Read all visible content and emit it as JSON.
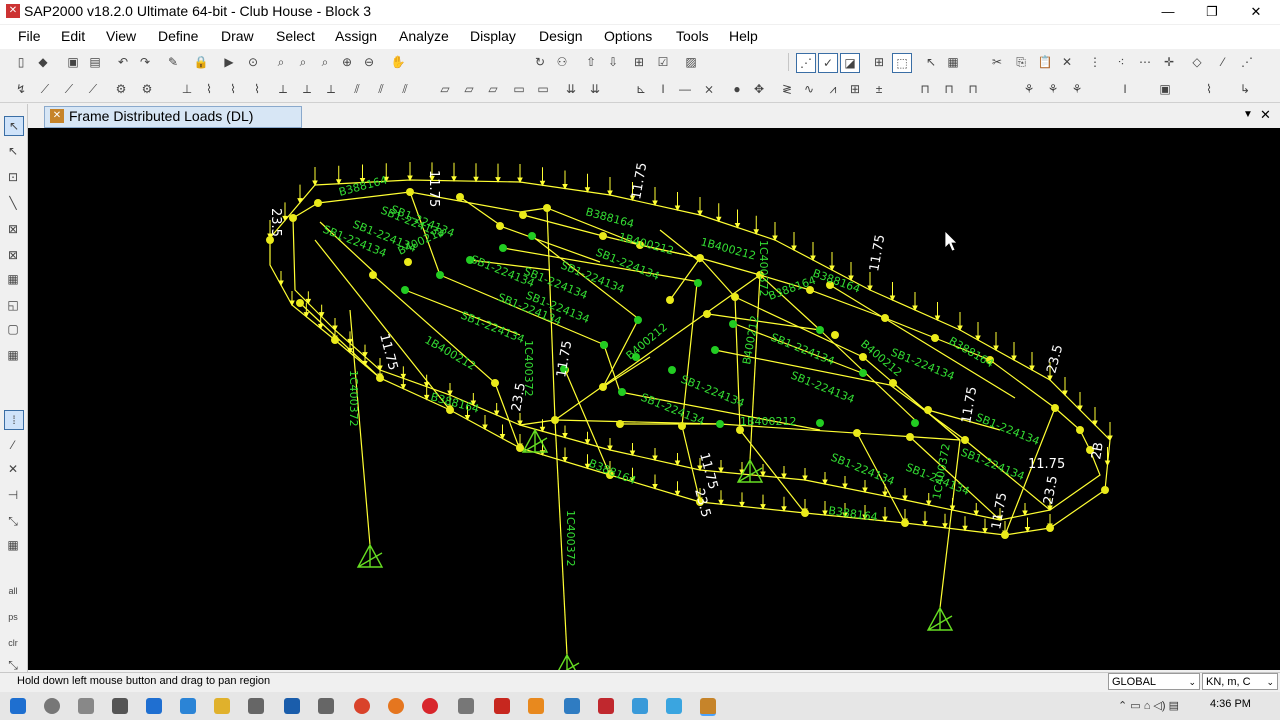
{
  "window": {
    "title": "SAP2000 v18.2.0 Ultimate 64-bit - Club House - Block 3",
    "icon": "sap2000-logo-icon",
    "controls": [
      "—",
      "❐",
      "✕"
    ]
  },
  "menu": [
    "File",
    "Edit",
    "View",
    "Define",
    "Draw",
    "Select",
    "Assign",
    "Analyze",
    "Display",
    "Design",
    "Options",
    "Tools",
    "Help"
  ],
  "toolbar": {
    "view_buttons": [
      "3-d",
      "xy",
      "xz",
      "yz",
      "nv"
    ]
  },
  "tab": {
    "label": "Frame Distributed Loads (DL)",
    "dropdown_glyph": "▼",
    "close_glyph": "✕"
  },
  "model": {
    "labels": {
      "beam_small": [
        "B388164",
        "B388164",
        "B388164",
        "B388164",
        "B388164",
        "B388164",
        "B388164",
        "B388164"
      ],
      "beam_sb": [
        "SB1-224134",
        "SB1-224134",
        "SB1-224134",
        "SB1-224134",
        "SB1-224134",
        "SB1-224134",
        "SB1-224134",
        "SB1-224134",
        "SB1-224134",
        "SB1-224134",
        "SB1-224134",
        "SB1-224134",
        "SB1-224134",
        "SB1-224134",
        "SB1-224134",
        "SB1-224134",
        "SB1-224134",
        "SB1-224134",
        "SB1-224134",
        "SB1-224134"
      ],
      "beam_b400": [
        "B400212",
        "1B400212",
        "1B400212",
        "B400212",
        "1B400212",
        "B400212",
        "B400212",
        "1B400212"
      ],
      "column": [
        "1C400372",
        "1C400372",
        "1C400372",
        "1C400372",
        "1C400372"
      ],
      "load_values": [
        "11.75",
        "23.5",
        "11.75",
        "11.75",
        "23.5",
        "11.75",
        "11.75",
        "11.75",
        "23.5",
        "11.75",
        "23.5",
        "11.75",
        "11.75",
        "2B",
        "23.5"
      ]
    }
  },
  "status": {
    "hint": "Hold down left mouse button and drag to pan region",
    "coord_system": "GLOBAL",
    "units": "KN, m, C"
  },
  "taskbar": {
    "time": "4:36 PM"
  }
}
